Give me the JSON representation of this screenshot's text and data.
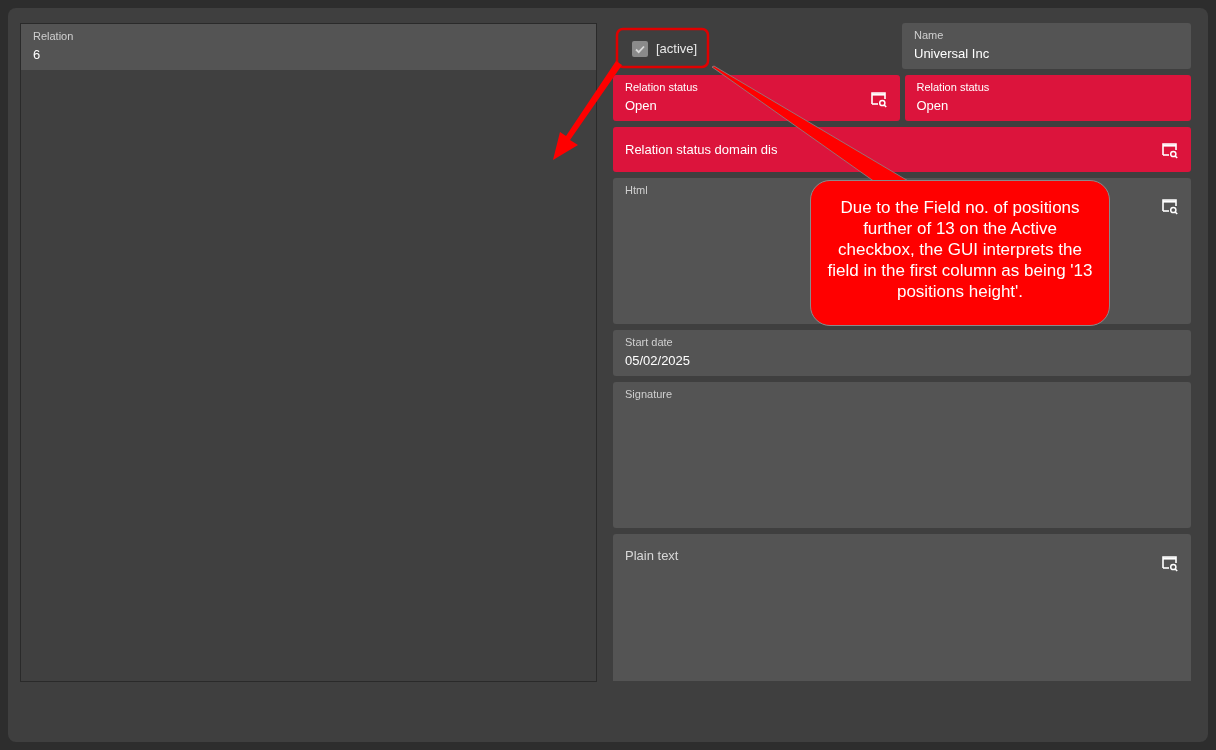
{
  "left_field": {
    "label": "Relation",
    "value": "6"
  },
  "rows": [
    [
      {
        "kind": "checkbox",
        "label": "[active]",
        "checked": true
      },
      {
        "kind": "field",
        "label": "Name",
        "value": "Universal Inc",
        "highlighted": false,
        "lookup": false
      }
    ],
    [
      {
        "kind": "field",
        "label": "Relation status",
        "value": "Open",
        "highlighted": true,
        "lookup": true
      },
      {
        "kind": "field",
        "label": "Relation status",
        "value": "Open",
        "highlighted": true,
        "lookup": false
      }
    ],
    [
      {
        "kind": "title",
        "label": "Relation status domain dis",
        "highlighted": true,
        "lookup": true
      }
    ],
    [
      {
        "kind": "tall",
        "label": "Html",
        "highlighted": false,
        "lookup": true
      }
    ],
    [
      {
        "kind": "field",
        "label": "Start date",
        "value": "05/02/2025",
        "highlighted": false,
        "lookup": false
      }
    ],
    [
      {
        "kind": "tall",
        "label": "Signature",
        "highlighted": false,
        "lookup": false
      }
    ],
    [
      {
        "kind": "textarea",
        "placeholder": "Plain text",
        "highlighted": false,
        "lookup": true
      }
    ]
  ],
  "annotation": {
    "text": "Due to the Field no. of positions further of 13 on the Active checkbox, the GUI interprets the field in the first column as being '13 positions height'."
  }
}
